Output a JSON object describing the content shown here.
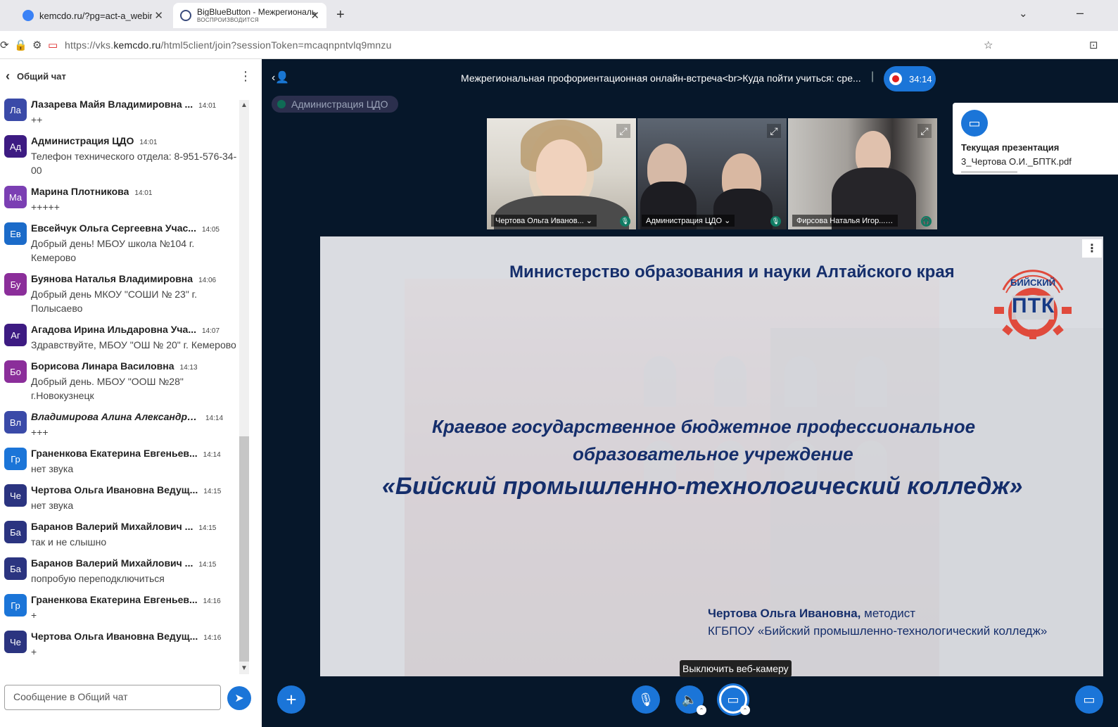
{
  "browser": {
    "tabs": [
      {
        "title": "kemcdo.ru/?pg=act-a_webinar",
        "subtitle": ""
      },
      {
        "title": "BigBlueButton - Межрегиональ",
        "subtitle": "ВОСПРОИЗВОДИТСЯ"
      }
    ],
    "url_prefix": "https://vks.",
    "url_domain": "kemcdo.ru",
    "url_path": "/html5client/join?sessionToken=mcaqnpntvlq9mnzu"
  },
  "chat": {
    "title": "Общий чат",
    "input_placeholder": "Сообщение в Общий чат",
    "messages": [
      {
        "avatar": "Ла",
        "color": "#3a4aa8",
        "name": "Лазарева Майя Владимировна ...",
        "time": "14:01",
        "text": "++"
      },
      {
        "avatar": "Ад",
        "color": "#3d1b82",
        "name": "Администрация ЦДО",
        "time": "14:01",
        "text": "Телефон технического отдела: 8-951-576-34-00"
      },
      {
        "avatar": "Ма",
        "color": "#7b3fb3",
        "name": "Марина Плотникова",
        "time": "14:01",
        "text": "+++++"
      },
      {
        "avatar": "Ев",
        "color": "#1b6bc9",
        "name": "Евсейчук Ольга Сергеевна Учас...",
        "time": "14:05",
        "text": "Добрый день! МБОУ школа №104 г. Кемерово"
      },
      {
        "avatar": "Бу",
        "color": "#8b2e9a",
        "name": "Буянова Наталья Владимировна",
        "time": "14:06",
        "text": "Добрый день МКОУ \"СОШИ № 23\" г. Полысаево"
      },
      {
        "avatar": "Аг",
        "color": "#3d1b82",
        "name": "Агадова Ирина Ильдаровна Уча...",
        "time": "14:07",
        "text": "Здравствуйте, МБОУ \"ОШ № 20\" г. Кемерово"
      },
      {
        "avatar": "Бо",
        "color": "#8b2e9a",
        "name": "Борисова Линара Василовна",
        "time": "14:13",
        "text": "Добрый день. МБОУ \"ООШ №28\" г.Новокузнецк"
      },
      {
        "avatar": "Вл",
        "color": "#3a4aa8",
        "name": "Владимирова Алина Александро...",
        "time": "14:14",
        "text": "+++"
      },
      {
        "avatar": "Гр",
        "color": "#1b75d8",
        "name": "Граненкова Екатерина Евгеньев...",
        "time": "14:14",
        "text": "нет звука"
      },
      {
        "avatar": "Че",
        "color": "#2b3480",
        "name": "Чертова Ольга Ивановна Ведущ...",
        "time": "14:15",
        "text": "нет звука"
      },
      {
        "avatar": "Ба",
        "color": "#2b3480",
        "name": "Баранов Валерий Михайлович ...",
        "time": "14:15",
        "text": "так и не слышно"
      },
      {
        "avatar": "Ба",
        "color": "#2b3480",
        "name": "Баранов Валерий Михайлович ...",
        "time": "14:15",
        "text": "попробую переподключиться"
      },
      {
        "avatar": "Гр",
        "color": "#1b75d8",
        "name": "Граненкова Екатерина Евгеньев...",
        "time": "14:16",
        "text": "+"
      },
      {
        "avatar": "Че",
        "color": "#2b3480",
        "name": "Чертова Ольга Ивановна Ведущ...",
        "time": "14:16",
        "text": "+"
      }
    ]
  },
  "meeting": {
    "title": "Межрегиональная профориентационная онлайн-встреча<br>Куда пойти учиться: сре...",
    "recording_time": "34:14",
    "talker": "Администрация ЦДО",
    "videos": [
      {
        "label": "Чертова Ольга Иванов... ⌄",
        "mic": "🎙"
      },
      {
        "label": "Администрация ЦДО ⌄",
        "mic": "🎙"
      },
      {
        "label": "Фирсова Наталья Игор... ⌄",
        "mic": "🎧"
      }
    ],
    "presentation_card": {
      "title": "Текущая презентация",
      "file": "3_Чертова О.И._БПТК.pdf"
    },
    "tooltip": "Выключить веб-камеру"
  },
  "slide": {
    "ministry": "Министерство образования и науки Алтайского края",
    "line1": "Краевое государственное бюджетное профессиональное",
    "line2": "образовательное учреждение",
    "line3": "«Бийский промышленно-технологический колледж»",
    "author_name": "Чертова Ольга Ивановна,",
    "author_role": " методист",
    "college": "КГБПОУ «Бийский промышленно-технологический колледж»",
    "logo_top": "БИЙСКИЙ",
    "logo_main": "ПТК"
  }
}
